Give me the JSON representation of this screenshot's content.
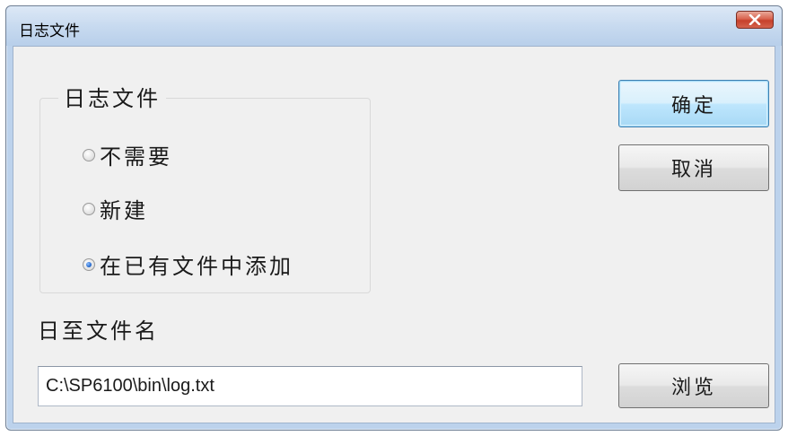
{
  "window": {
    "title": "日志文件"
  },
  "group": {
    "legend": "日志文件",
    "options": [
      {
        "label": "不需要",
        "checked": false
      },
      {
        "label": "新建",
        "checked": false
      },
      {
        "label": "在已有文件中添加",
        "checked": true
      }
    ]
  },
  "file": {
    "label": "日至文件名",
    "path": "C:\\SP6100\\bin\\log.txt"
  },
  "buttons": {
    "ok": "确定",
    "cancel": "取消",
    "browse": "浏览"
  },
  "colors": {
    "title_bar": "#c6d9ef",
    "close_button": "#c6402b",
    "dialog_background": "#f0f0f0",
    "default_button_border": "#3c7fb1"
  },
  "icons": {
    "close": "close-icon"
  }
}
